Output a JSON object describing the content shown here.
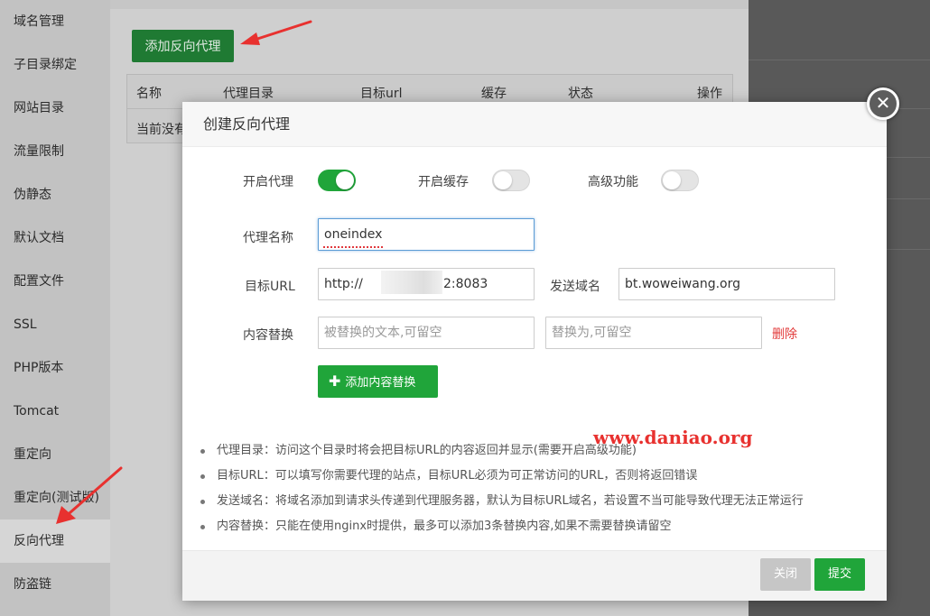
{
  "sidebar": {
    "items": [
      {
        "label": "域名管理"
      },
      {
        "label": "子目录绑定"
      },
      {
        "label": "网站目录"
      },
      {
        "label": "流量限制"
      },
      {
        "label": "伪静态"
      },
      {
        "label": "默认文档"
      },
      {
        "label": "配置文件"
      },
      {
        "label": "SSL"
      },
      {
        "label": "PHP版本"
      },
      {
        "label": "Tomcat"
      },
      {
        "label": "重定向"
      },
      {
        "label": "重定向(测试版)"
      },
      {
        "label": "反向代理"
      },
      {
        "label": "防盗链"
      }
    ],
    "active_index": 12
  },
  "page": {
    "add_button": "添加反向代理",
    "table": {
      "headers": [
        "名称",
        "代理目录",
        "目标url",
        "缓存",
        "状态",
        "操作"
      ],
      "empty_text": "当前没有"
    }
  },
  "modal": {
    "title": "创建反向代理",
    "close_icon": "close-icon",
    "toggles": [
      {
        "label": "开启代理",
        "on": true
      },
      {
        "label": "开启缓存",
        "on": false
      },
      {
        "label": "高级功能",
        "on": false
      }
    ],
    "proxy_name": {
      "label": "代理名称",
      "value": "oneindex"
    },
    "target_url": {
      "label": "目标URL",
      "prefix": "http://",
      "suffix": "2:8083"
    },
    "send_domain": {
      "label": "发送域名",
      "value": "bt.woweiwang.org"
    },
    "content_replace": {
      "label": "内容替换",
      "from_placeholder": "被替换的文本,可留空",
      "to_placeholder": "替换为,可留空",
      "delete_label": "删除"
    },
    "add_replace_button": {
      "icon": "plus-icon",
      "label": "添加内容替换"
    },
    "notes": [
      "代理目录：访问这个目录时将会把目标URL的内容返回并显示(需要开启高级功能)",
      "目标URL：可以填写你需要代理的站点，目标URL必须为可正常访问的URL，否则将返回错误",
      "发送域名：将域名添加到请求头传递到代理服务器，默认为目标URL域名，若设置不当可能导致代理无法正常运行",
      "内容替换：只能在使用nginx时提供，最多可以添加3条替换内容,如果不需要替换请留空"
    ],
    "footer": {
      "close_label": "关闭",
      "submit_label": "提交"
    }
  },
  "watermark": "www.daniao.org",
  "colors": {
    "primary_green": "#20a53a",
    "danger_red": "#e23a3a",
    "annotation_arrow": "#e8312f"
  }
}
